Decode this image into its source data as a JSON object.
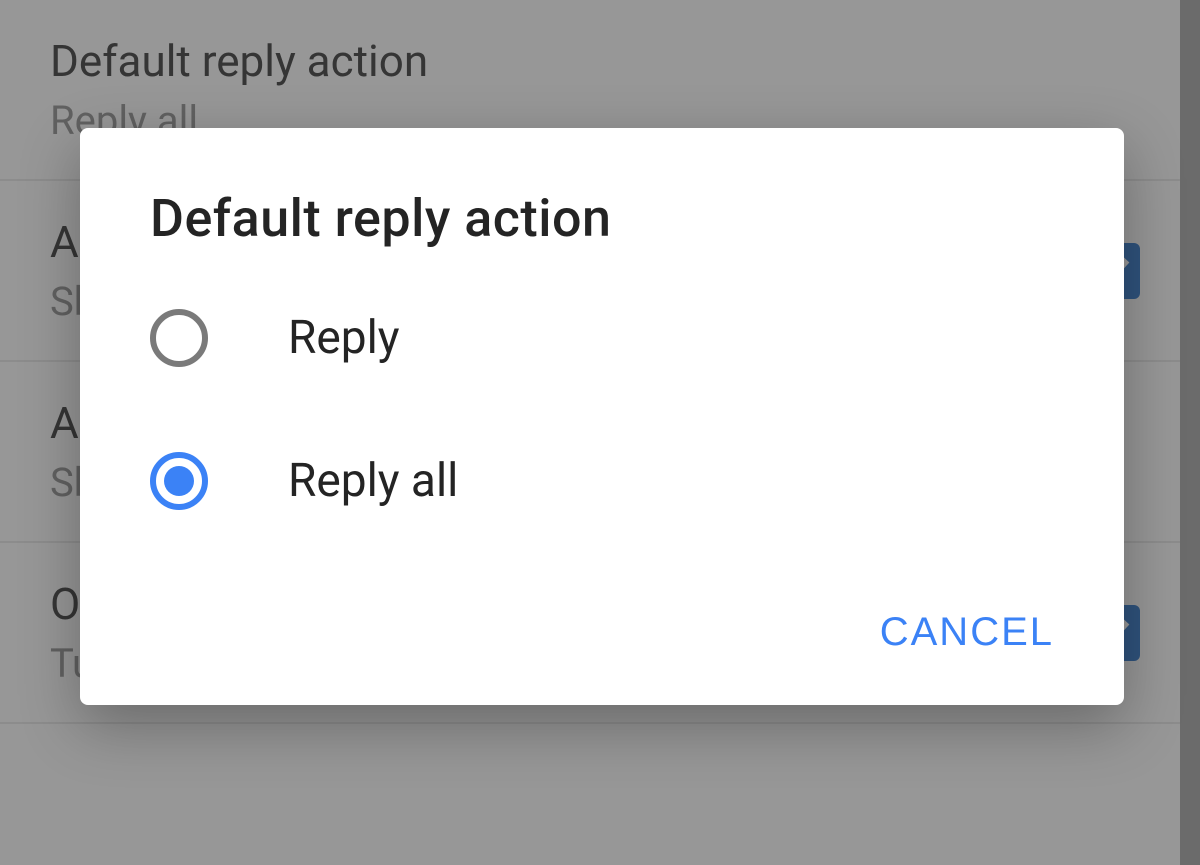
{
  "settings": {
    "items": [
      {
        "title": "Default reply action",
        "subtitle": "Reply all"
      },
      {
        "title": "Auto-fit messages",
        "subtitle": "Shrink messages to fit the screen"
      },
      {
        "title": "Auto-advance",
        "subtitle": "Show conversation list after you archive or delete"
      },
      {
        "title": "Open web links in Gmail",
        "subtitle": "Turn on for faster browsing"
      }
    ]
  },
  "dialog": {
    "title": "Default reply action",
    "options": [
      {
        "label": "Reply",
        "selected": false
      },
      {
        "label": "Reply all",
        "selected": true
      }
    ],
    "cancel_label": "CANCEL"
  },
  "colors": {
    "accent": "#3b82f6",
    "checkbox_bg": "#1565c0"
  }
}
